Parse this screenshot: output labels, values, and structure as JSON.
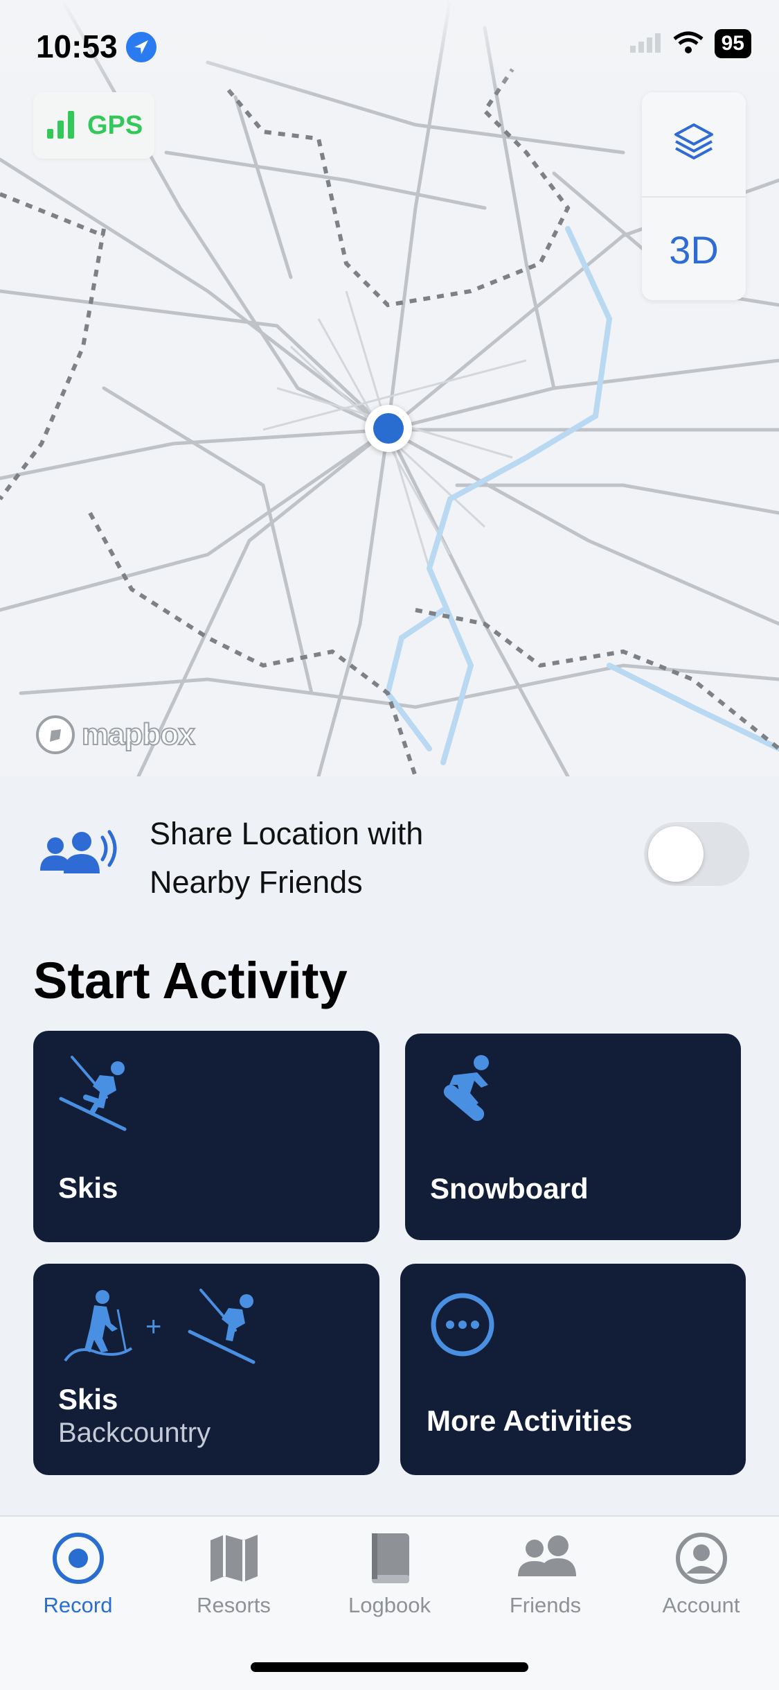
{
  "status_bar": {
    "time": "10:53",
    "battery": "95"
  },
  "map": {
    "gps_label": "GPS",
    "control_3d_label": "3D",
    "attribution": "mapbox"
  },
  "share": {
    "line1": "Share Location with",
    "line2": "Nearby Friends",
    "toggle_on": false
  },
  "start_activity": {
    "title": "Start Activity",
    "cards": [
      {
        "label": "Skis",
        "icon": "skier-icon"
      },
      {
        "label": "Snowboard",
        "icon": "snowboarder-icon"
      },
      {
        "label": "Skis",
        "sublabel": "Backcountry",
        "icon": "backcountry-icon"
      },
      {
        "label": "More Activities",
        "icon": "more-icon"
      }
    ]
  },
  "tabs": [
    {
      "label": "Record",
      "active": true,
      "icon": "record-icon"
    },
    {
      "label": "Resorts",
      "icon": "map-icon"
    },
    {
      "label": "Logbook",
      "icon": "book-icon"
    },
    {
      "label": "Friends",
      "icon": "friends-icon"
    },
    {
      "label": "Account",
      "icon": "account-icon"
    }
  ],
  "colors": {
    "accent": "#2a6dd0",
    "card_bg": "#121e38",
    "gps_green": "#34c759",
    "icon_blue": "#4a90e2"
  }
}
